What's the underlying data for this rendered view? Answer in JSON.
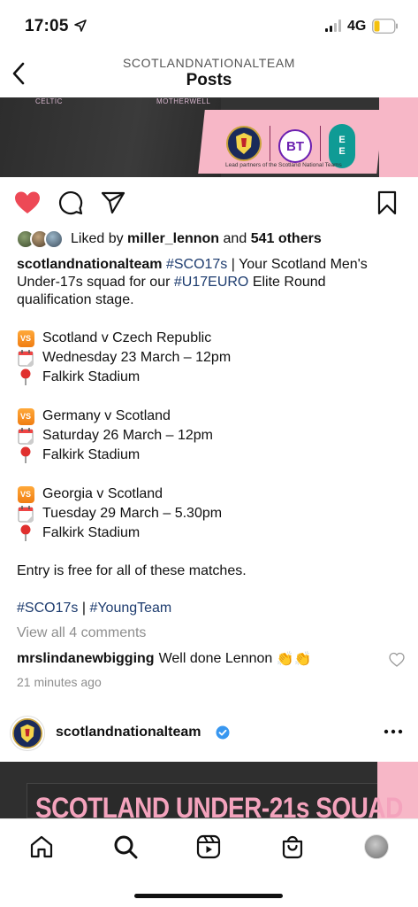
{
  "status": {
    "time": "17:05",
    "network": "4G"
  },
  "nav": {
    "account": "SCOTLANDNATIONALTEAM",
    "title": "Posts"
  },
  "banner": {
    "label_left": "CELTIC",
    "label_right": "MOTHERWELL",
    "bt": "BT",
    "ee": [
      "E",
      "E"
    ],
    "note": "Lead partners of the Scotland National Teams"
  },
  "likes": {
    "prefix": "Liked by",
    "user": "miller_lennon",
    "and": "and",
    "others": "541 others"
  },
  "caption": {
    "user": "scotlandnationalteam",
    "tag1": "#SCO17s",
    "text1": "| Your Scotland Men's",
    "line2_pre": "Under-17s squad for our",
    "tag2": "#U17EURO",
    "line2_post": "Elite Round",
    "line3": "qualification stage.",
    "matches": [
      {
        "fixture": "Scotland v Czech Republic",
        "date": "Wednesday 23 March – 12pm",
        "venue": "Falkirk Stadium"
      },
      {
        "fixture": "Germany v Scotland",
        "date": "Saturday 26 March – 12pm",
        "venue": "Falkirk Stadium"
      },
      {
        "fixture": "Georgia v Scotland",
        "date": "Tuesday 29 March – 5.30pm",
        "venue": "Falkirk Stadium"
      }
    ],
    "vs_label": "VS",
    "entry": "Entry is free for all of these matches.",
    "tag3": "#SCO17s",
    "sep": "|",
    "tag4": "#YoungTeam"
  },
  "comments": {
    "view_all": "View all 4 comments",
    "user": "mrslindanewbigging",
    "text": "Well done Lennon",
    "emoji": "👏👏",
    "time": "21 minutes ago"
  },
  "next_post": {
    "user": "scotlandnationalteam",
    "image_text": "SCOTLAND UNDER-21s SQUAD"
  },
  "colors": {
    "like_red": "#ed4956",
    "hashtag": "#1c3b6e",
    "banner_pink": "#f7b7c7",
    "ee_teal": "#0f9b95",
    "bt_purple": "#6b1fb0"
  }
}
